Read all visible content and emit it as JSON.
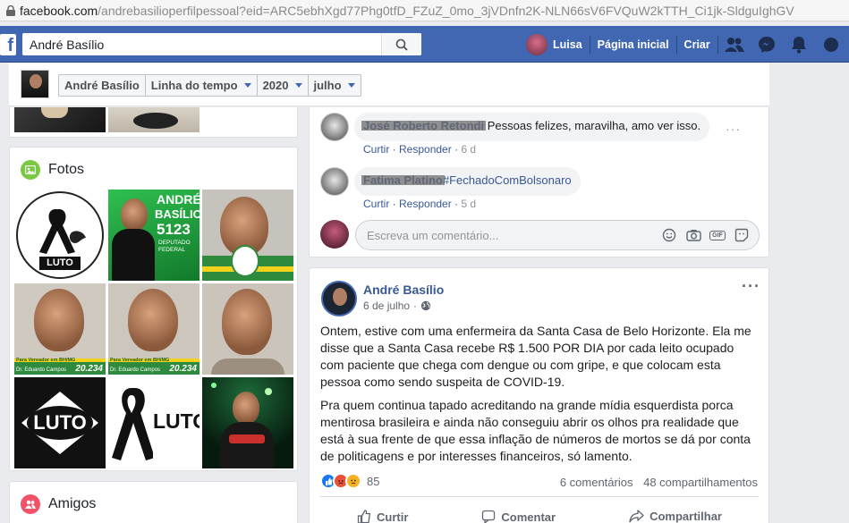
{
  "browser": {
    "url_host": "facebook.com",
    "url_rest": "/andrebasilioperfilpessoal?eid=ARC5ebhXgd77Phg0tfD_FZuZ_0mo_3jVDnfn2K-NLN66sV6FVQuW2kTTH_Ci1jk-SldguIghGV"
  },
  "topbar": {
    "logo": "f",
    "search_value": "André Basílio",
    "user_name": "Luisa",
    "home_label": "Página inicial",
    "create_label": "Criar"
  },
  "timeline_header": {
    "crumbs": [
      "André Basílio",
      "Linha do tempo",
      "2020",
      "julho"
    ]
  },
  "left": {
    "photos_title": "Fotos",
    "friends_title": "Amigos",
    "photo_texts": {
      "luto1": "LUTO",
      "andre": "ANDRÉ",
      "basilio": "BASÍLIO",
      "number": "5123",
      "deputado": "DEPUTADO FEDERAL",
      "vereador": "Para Vereador em BH/MG",
      "eduardo": "Dr. Eduardo Campos",
      "num2": "20.234",
      "luto2": "LUTO",
      "luto3": "LUTO"
    }
  },
  "comments": [
    {
      "author": "José Roberto Retondi",
      "text": "Pessoas felizes, maravilha, amo ver isso.",
      "like": "Curtir",
      "reply": "Responder",
      "time": "6 d"
    },
    {
      "author": "Fatima Platino",
      "text": "#FechadoComBolsonaro",
      "like": "Curtir",
      "reply": "Responder",
      "time": "5 d"
    }
  ],
  "write_placeholder": "Escreva um comentário...",
  "gif_label": "GIF",
  "post": {
    "author": "André Basílio",
    "date": "6 de julho",
    "para1": "Ontem, estive com uma enfermeira da Santa Casa de Belo Horizonte. Ela me disse que a Santa Casa recebe R$ 1.500 POR DIA por cada leito ocupado com paciente que chega com dengue ou com gripe, e que colocam esta pessoa como sendo suspeita de COVID-19.",
    "para2": "Pra quem continua tapado acreditando na grande mídia esquerdista porca mentirosa brasileira e ainda não conseguiu abrir os olhos pra realidade que está à sua frente de que essa inflação de números de mortos se dá por conta de politicagens e por interesses financeiros, só lamento.",
    "reaction_count": "85",
    "comments_count": "6 comentários",
    "shares_count": "48 compartilhamentos",
    "action_like": "Curtir",
    "action_comment": "Comentar",
    "action_share": "Compartilhar"
  },
  "colors": {
    "fb_blue": "#4267b2",
    "link": "#385898",
    "background": "#e9ebee"
  }
}
